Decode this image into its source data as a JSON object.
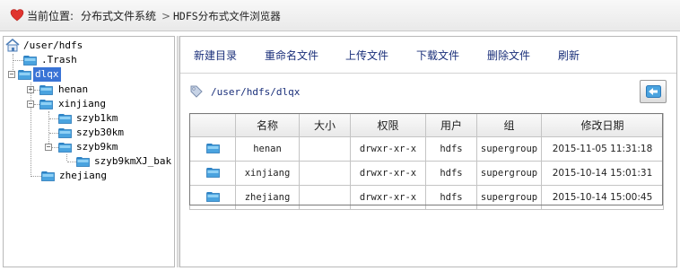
{
  "breadcrumb": {
    "lead": "当前位置:",
    "crumb1": "分布式文件系统",
    "separator": ">",
    "crumb2": "HDFS分布式文件浏览器"
  },
  "tree": {
    "root": "/user/hdfs",
    "nodes": [
      {
        "label": "/user/hdfs"
      },
      {
        "label": ".Trash"
      },
      {
        "label": "dlqx"
      },
      {
        "label": "henan"
      },
      {
        "label": "xinjiang"
      },
      {
        "label": "szyb1km"
      },
      {
        "label": "szyb30km"
      },
      {
        "label": "szyb9km"
      },
      {
        "label": "szyb9kmXJ_bak"
      },
      {
        "label": "zhejiang"
      }
    ]
  },
  "toolbar": {
    "new_dir": "新建目录",
    "rename": "重命名文件",
    "upload": "上传文件",
    "download": "下载文件",
    "delete": "删除文件",
    "refresh": "刷新"
  },
  "path": "/user/hdfs/dlqx",
  "table": {
    "headers": [
      "",
      "名称",
      "大小",
      "权限",
      "用户",
      "组",
      "修改日期"
    ],
    "rows": [
      {
        "name": "henan",
        "size": "",
        "perm": "drwxr-xr-x",
        "user": "hdfs",
        "group": "supergroup",
        "date": "2015-11-05 11:31:18"
      },
      {
        "name": "xinjiang",
        "size": "",
        "perm": "drwxr-xr-x",
        "user": "hdfs",
        "group": "supergroup",
        "date": "2015-10-14 15:01:31"
      },
      {
        "name": "zhejiang",
        "size": "",
        "perm": "drwxr-xr-x",
        "user": "hdfs",
        "group": "supergroup",
        "date": "2015-10-14 15:00:45"
      }
    ]
  },
  "colors": {
    "accent_link": "#1a2f7a",
    "selection": "#3a74d6",
    "folder": "#4aa3df",
    "heart": "#e0342f"
  }
}
